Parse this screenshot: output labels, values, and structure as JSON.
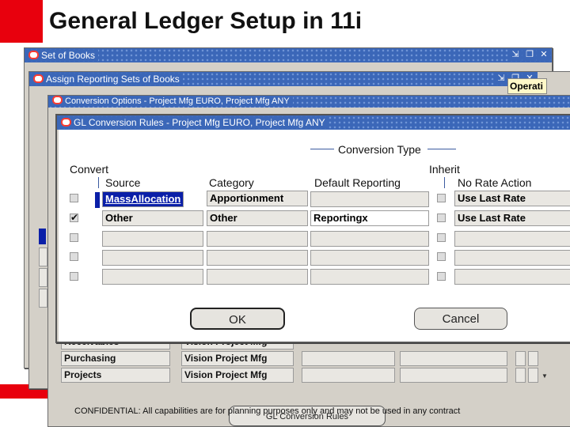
{
  "slide": {
    "title": "General Ledger Setup in 11i",
    "footer": "CONFIDENTIAL:  All capabilities are for planning purposes only and may not be used in any contract",
    "accent_color": "#e8000d"
  },
  "windows": {
    "set_of_books": {
      "title": "Set of Books"
    },
    "assign_reporting": {
      "title": "Assign Reporting Sets of Books",
      "side_label": "Operati"
    },
    "conversion_options": {
      "title": "Conversion Options - Project Mfg EURO, Project Mfg ANY"
    },
    "gl_rules": {
      "title": "GL Conversion Rules - Project Mfg EURO, Project Mfg ANY"
    }
  },
  "titlebar_icons": [
    "arrow-icon",
    "restore-icon",
    "close-icon"
  ],
  "gl_rules": {
    "group_label": "Conversion Type",
    "convert_label": "Convert",
    "inherit_label": "Inherit",
    "columns": {
      "source": "Source",
      "category": "Category",
      "default_reporting": "Default Reporting",
      "no_rate_action": "No Rate Action"
    },
    "rows": [
      {
        "convert": false,
        "source": "MassAllocation",
        "category": "Apportionment",
        "default_reporting": "",
        "inherit": false,
        "no_rate_action": "Use Last Rate"
      },
      {
        "convert": true,
        "source": "Other",
        "category": "Other",
        "default_reporting": "Reportingx",
        "inherit": false,
        "no_rate_action": "Use Last Rate"
      },
      {
        "convert": false,
        "source": "",
        "category": "",
        "default_reporting": "",
        "inherit": false,
        "no_rate_action": ""
      },
      {
        "convert": false,
        "source": "",
        "category": "",
        "default_reporting": "",
        "inherit": false,
        "no_rate_action": ""
      },
      {
        "convert": false,
        "source": "",
        "category": "",
        "default_reporting": "",
        "inherit": false,
        "no_rate_action": ""
      }
    ],
    "ok_label": "OK",
    "cancel_label": "Cancel"
  },
  "background_rows": [
    {
      "source": "Receivables",
      "sob": "Vision Project Mfg"
    },
    {
      "source": "Purchasing",
      "sob": "Vision Project Mfg"
    },
    {
      "source": "Projects",
      "sob": "Vision Project Mfg"
    }
  ],
  "bottom_button": "GL Conversion Rules"
}
